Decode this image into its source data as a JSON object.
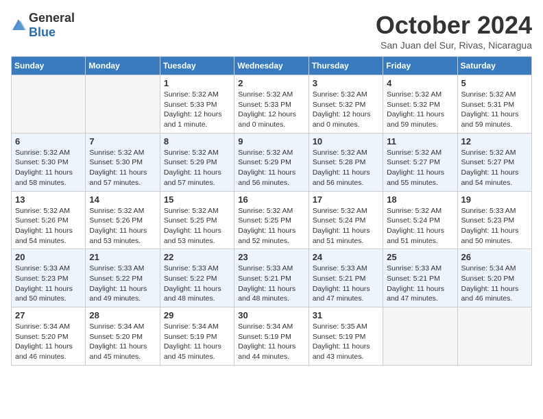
{
  "header": {
    "logo_general": "General",
    "logo_blue": "Blue",
    "month_title": "October 2024",
    "subtitle": "San Juan del Sur, Rivas, Nicaragua"
  },
  "weekdays": [
    "Sunday",
    "Monday",
    "Tuesday",
    "Wednesday",
    "Thursday",
    "Friday",
    "Saturday"
  ],
  "weeks": [
    [
      {
        "day": "",
        "info": ""
      },
      {
        "day": "",
        "info": ""
      },
      {
        "day": "1",
        "info": "Sunrise: 5:32 AM\nSunset: 5:33 PM\nDaylight: 12 hours\nand 1 minute."
      },
      {
        "day": "2",
        "info": "Sunrise: 5:32 AM\nSunset: 5:33 PM\nDaylight: 12 hours\nand 0 minutes."
      },
      {
        "day": "3",
        "info": "Sunrise: 5:32 AM\nSunset: 5:32 PM\nDaylight: 12 hours\nand 0 minutes."
      },
      {
        "day": "4",
        "info": "Sunrise: 5:32 AM\nSunset: 5:32 PM\nDaylight: 11 hours\nand 59 minutes."
      },
      {
        "day": "5",
        "info": "Sunrise: 5:32 AM\nSunset: 5:31 PM\nDaylight: 11 hours\nand 59 minutes."
      }
    ],
    [
      {
        "day": "6",
        "info": "Sunrise: 5:32 AM\nSunset: 5:30 PM\nDaylight: 11 hours\nand 58 minutes."
      },
      {
        "day": "7",
        "info": "Sunrise: 5:32 AM\nSunset: 5:30 PM\nDaylight: 11 hours\nand 57 minutes."
      },
      {
        "day": "8",
        "info": "Sunrise: 5:32 AM\nSunset: 5:29 PM\nDaylight: 11 hours\nand 57 minutes."
      },
      {
        "day": "9",
        "info": "Sunrise: 5:32 AM\nSunset: 5:29 PM\nDaylight: 11 hours\nand 56 minutes."
      },
      {
        "day": "10",
        "info": "Sunrise: 5:32 AM\nSunset: 5:28 PM\nDaylight: 11 hours\nand 56 minutes."
      },
      {
        "day": "11",
        "info": "Sunrise: 5:32 AM\nSunset: 5:27 PM\nDaylight: 11 hours\nand 55 minutes."
      },
      {
        "day": "12",
        "info": "Sunrise: 5:32 AM\nSunset: 5:27 PM\nDaylight: 11 hours\nand 54 minutes."
      }
    ],
    [
      {
        "day": "13",
        "info": "Sunrise: 5:32 AM\nSunset: 5:26 PM\nDaylight: 11 hours\nand 54 minutes."
      },
      {
        "day": "14",
        "info": "Sunrise: 5:32 AM\nSunset: 5:26 PM\nDaylight: 11 hours\nand 53 minutes."
      },
      {
        "day": "15",
        "info": "Sunrise: 5:32 AM\nSunset: 5:25 PM\nDaylight: 11 hours\nand 53 minutes."
      },
      {
        "day": "16",
        "info": "Sunrise: 5:32 AM\nSunset: 5:25 PM\nDaylight: 11 hours\nand 52 minutes."
      },
      {
        "day": "17",
        "info": "Sunrise: 5:32 AM\nSunset: 5:24 PM\nDaylight: 11 hours\nand 51 minutes."
      },
      {
        "day": "18",
        "info": "Sunrise: 5:32 AM\nSunset: 5:24 PM\nDaylight: 11 hours\nand 51 minutes."
      },
      {
        "day": "19",
        "info": "Sunrise: 5:33 AM\nSunset: 5:23 PM\nDaylight: 11 hours\nand 50 minutes."
      }
    ],
    [
      {
        "day": "20",
        "info": "Sunrise: 5:33 AM\nSunset: 5:23 PM\nDaylight: 11 hours\nand 50 minutes."
      },
      {
        "day": "21",
        "info": "Sunrise: 5:33 AM\nSunset: 5:22 PM\nDaylight: 11 hours\nand 49 minutes."
      },
      {
        "day": "22",
        "info": "Sunrise: 5:33 AM\nSunset: 5:22 PM\nDaylight: 11 hours\nand 48 minutes."
      },
      {
        "day": "23",
        "info": "Sunrise: 5:33 AM\nSunset: 5:21 PM\nDaylight: 11 hours\nand 48 minutes."
      },
      {
        "day": "24",
        "info": "Sunrise: 5:33 AM\nSunset: 5:21 PM\nDaylight: 11 hours\nand 47 minutes."
      },
      {
        "day": "25",
        "info": "Sunrise: 5:33 AM\nSunset: 5:21 PM\nDaylight: 11 hours\nand 47 minutes."
      },
      {
        "day": "26",
        "info": "Sunrise: 5:34 AM\nSunset: 5:20 PM\nDaylight: 11 hours\nand 46 minutes."
      }
    ],
    [
      {
        "day": "27",
        "info": "Sunrise: 5:34 AM\nSunset: 5:20 PM\nDaylight: 11 hours\nand 46 minutes."
      },
      {
        "day": "28",
        "info": "Sunrise: 5:34 AM\nSunset: 5:20 PM\nDaylight: 11 hours\nand 45 minutes."
      },
      {
        "day": "29",
        "info": "Sunrise: 5:34 AM\nSunset: 5:19 PM\nDaylight: 11 hours\nand 45 minutes."
      },
      {
        "day": "30",
        "info": "Sunrise: 5:34 AM\nSunset: 5:19 PM\nDaylight: 11 hours\nand 44 minutes."
      },
      {
        "day": "31",
        "info": "Sunrise: 5:35 AM\nSunset: 5:19 PM\nDaylight: 11 hours\nand 43 minutes."
      },
      {
        "day": "",
        "info": ""
      },
      {
        "day": "",
        "info": ""
      }
    ]
  ]
}
